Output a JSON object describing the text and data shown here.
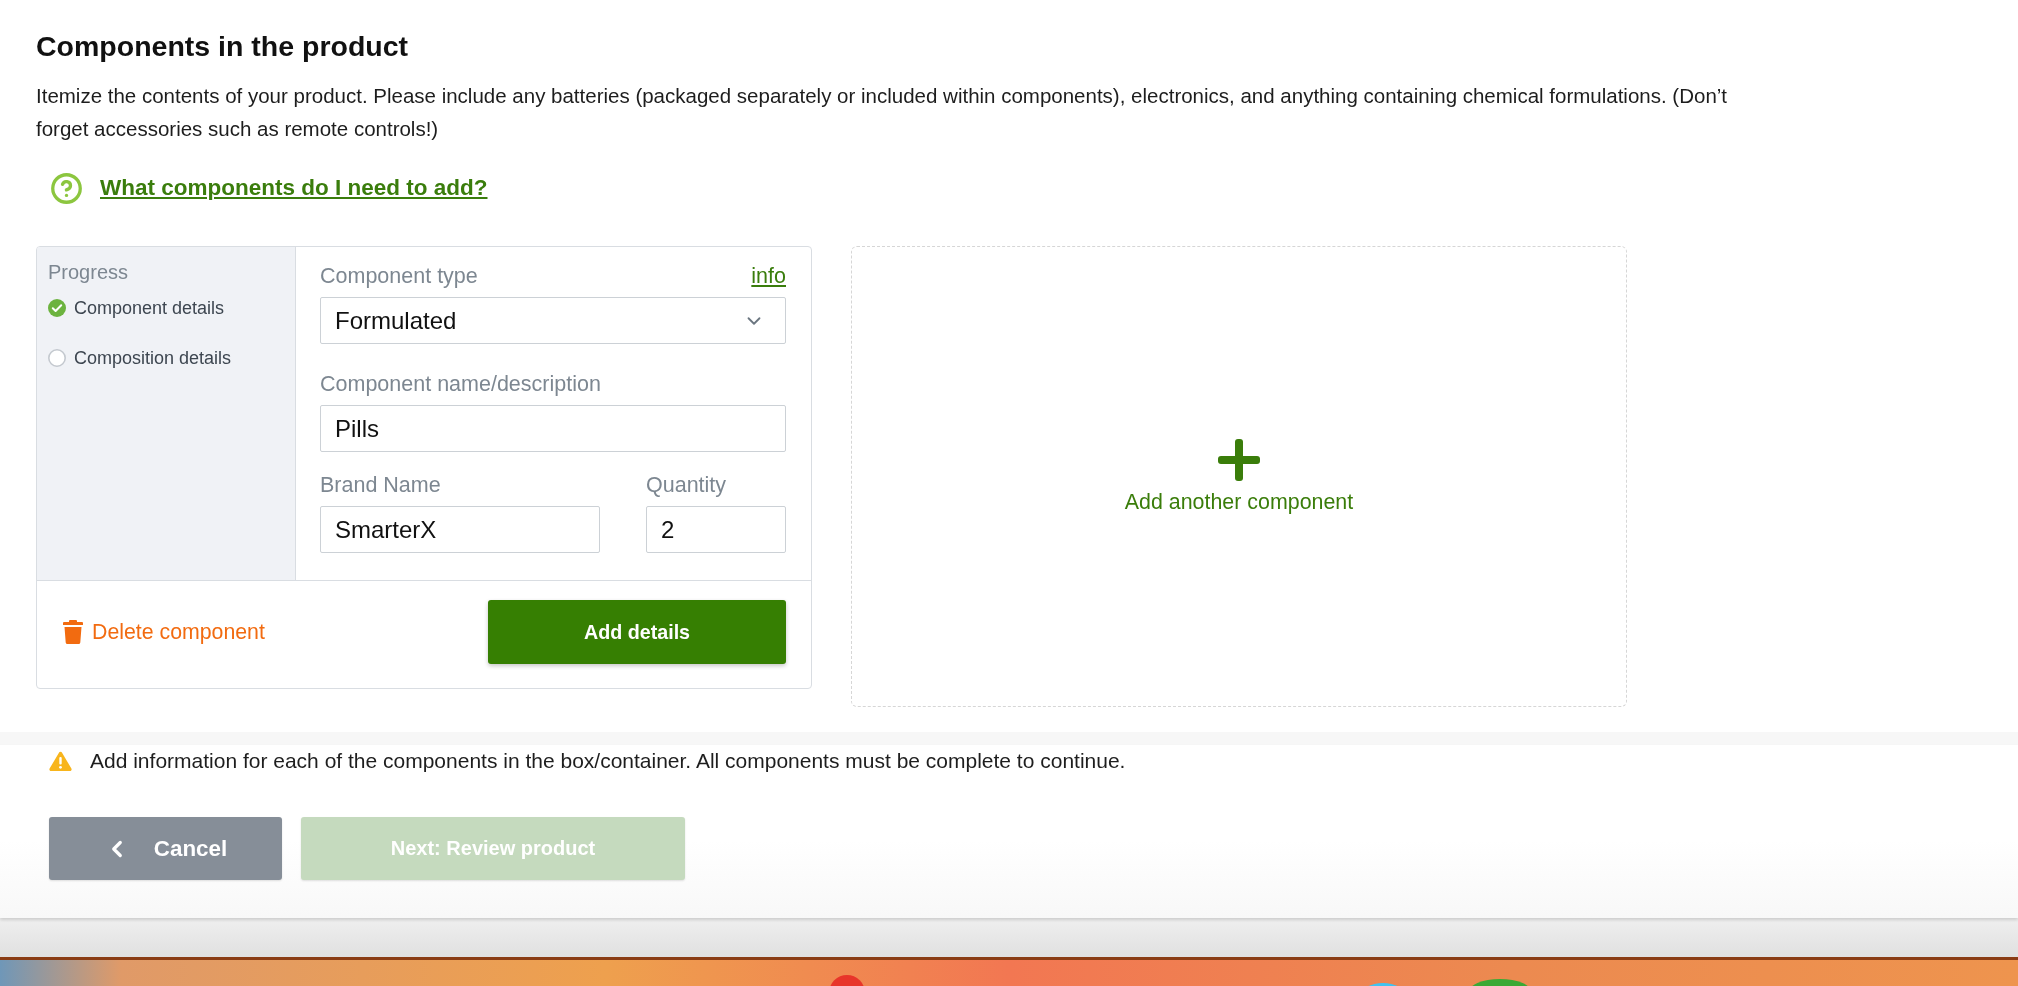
{
  "page": {
    "title": "Components in the product",
    "description": "Itemize the contents of your product. Please include any batteries (packaged separately or included within components), electronics, and anything containing chemical formulations. (Don’t forget accessories such as remote controls!)",
    "help_link": "What components do I need to add?"
  },
  "component_card": {
    "progress_title": "Progress",
    "steps": [
      {
        "label": "Component details",
        "completed": true
      },
      {
        "label": "Composition details",
        "completed": false
      }
    ],
    "component_type": {
      "label": "Component type",
      "info_link": "info",
      "value": "Formulated"
    },
    "name": {
      "label": "Component name/description",
      "value": "Pills"
    },
    "brand": {
      "label": "Brand Name",
      "value": "SmarterX"
    },
    "quantity": {
      "label": "Quantity",
      "value": "2"
    },
    "delete_button": "Delete component",
    "add_details_button": "Add details"
  },
  "add_card": {
    "label": "Add another component"
  },
  "warning": "Add information for each of the components in the box/container. All components must be complete to continue.",
  "buttons": [
    {
      "label": "Cancel",
      "kind": "back",
      "disabled": false
    },
    {
      "label": "Next: Review product",
      "kind": "primary",
      "disabled": true
    }
  ]
}
